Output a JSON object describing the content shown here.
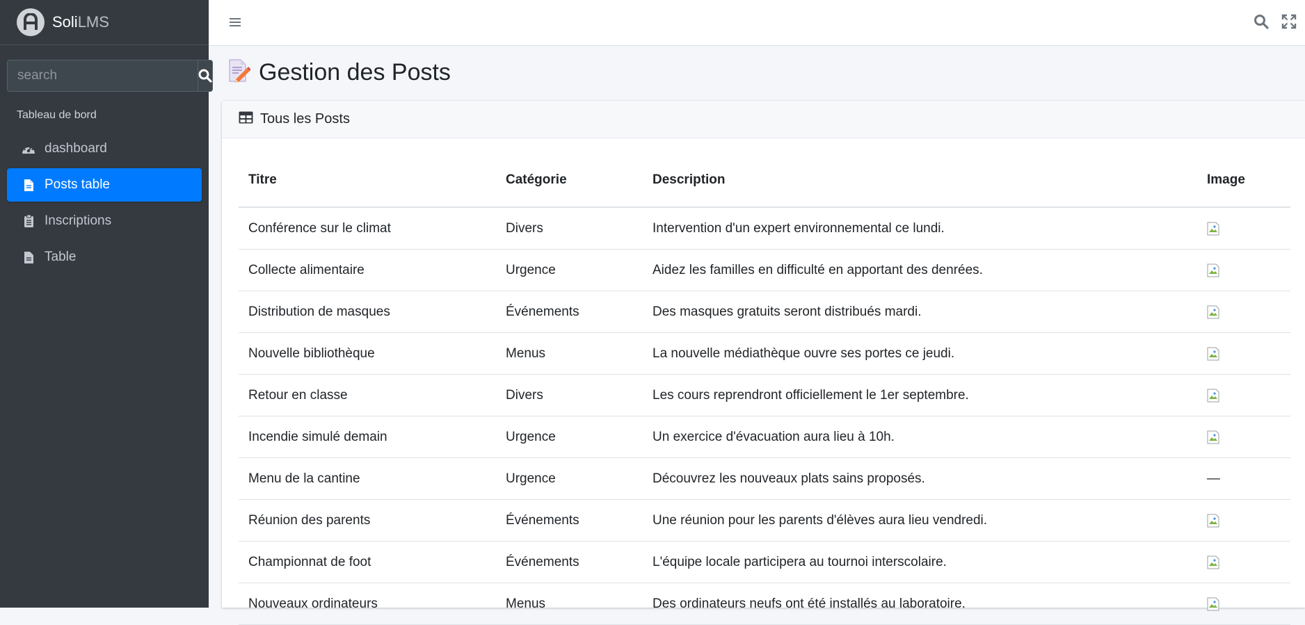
{
  "brand": {
    "name_main": "Soli",
    "name_light": "LMS"
  },
  "sidebar": {
    "search_placeholder": "search",
    "section_header": "Tableau de bord",
    "items": [
      {
        "label": "dashboard",
        "icon": "tachometer-icon",
        "active": false
      },
      {
        "label": "Posts table",
        "icon": "file-icon",
        "active": true
      },
      {
        "label": "Inscriptions",
        "icon": "clipboard-list-icon",
        "active": false
      },
      {
        "label": "Table",
        "icon": "file-icon",
        "active": false
      }
    ]
  },
  "topbar": {
    "icons": [
      "hamburger-icon",
      "search-icon",
      "expand-icon"
    ]
  },
  "page": {
    "title": "Gestion des Posts",
    "title_icon": "edit-document-icon"
  },
  "card": {
    "title": "Tous les Posts",
    "icon": "table-icon"
  },
  "table": {
    "headers": [
      "Titre",
      "Catégorie",
      "Description",
      "Image"
    ],
    "rows": [
      {
        "titre": "Conférence sur le climat",
        "categorie": "Divers",
        "description": "Intervention d'un expert environnemental ce lundi.",
        "image": "broken-image"
      },
      {
        "titre": "Collecte alimentaire",
        "categorie": "Urgence",
        "description": "Aidez les familles en difficulté en apportant des denrées.",
        "image": "broken-image"
      },
      {
        "titre": "Distribution de masques",
        "categorie": "Événements",
        "description": "Des masques gratuits seront distribués mardi.",
        "image": "broken-image"
      },
      {
        "titre": "Nouvelle bibliothèque",
        "categorie": "Menus",
        "description": "La nouvelle médiathèque ouvre ses portes ce jeudi.",
        "image": "broken-image"
      },
      {
        "titre": "Retour en classe",
        "categorie": "Divers",
        "description": "Les cours reprendront officiellement le 1er septembre.",
        "image": "broken-image"
      },
      {
        "titre": "Incendie simulé demain",
        "categorie": "Urgence",
        "description": "Un exercice d'évacuation aura lieu à 10h.",
        "image": "broken-image"
      },
      {
        "titre": "Menu de la cantine",
        "categorie": "Urgence",
        "description": "Découvrez les nouveaux plats sains proposés.",
        "image": "—"
      },
      {
        "titre": "Réunion des parents",
        "categorie": "Événements",
        "description": "Une réunion pour les parents d'élèves aura lieu vendredi.",
        "image": "broken-image"
      },
      {
        "titre": "Championnat de foot",
        "categorie": "Événements",
        "description": "L'équipe locale participera au tournoi interscolaire.",
        "image": "broken-image"
      },
      {
        "titre": "Nouveaux ordinateurs",
        "categorie": "Menus",
        "description": "Des ordinateurs neufs ont été installés au laboratoire.",
        "image": "broken-image"
      }
    ]
  },
  "colors": {
    "sidebar_bg": "#343a40",
    "active": "#007bff",
    "page_bg": "#f4f6f9"
  }
}
